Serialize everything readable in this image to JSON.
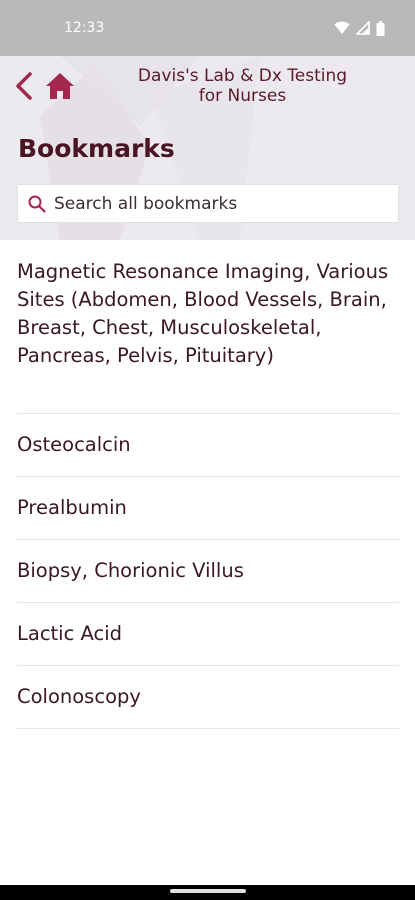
{
  "status_bar": {
    "time": "12:33",
    "icons": [
      "wifi-icon",
      "signal-icon",
      "battery-icon"
    ]
  },
  "header": {
    "title_line1": "Davis's Lab & Dx Testing",
    "title_line2": "for Nurses",
    "page_title": "Bookmarks",
    "back_icon": "chevron-left-icon",
    "home_icon": "home-icon"
  },
  "search": {
    "placeholder": "Search all bookmarks",
    "value": ""
  },
  "bookmarks": [
    "Magnetic Resonance Imaging, Various Sites (Abdomen, Blood Vessels, Brain, Breast, Chest, Musculoskeletal, Pancreas, Pelvis, Pituitary)",
    "Osteocalcin",
    "Prealbumin",
    "Biopsy, Chorionic Villus",
    "Lactic Acid",
    "Colonoscopy"
  ],
  "colors": {
    "accent": "#a3284e",
    "header_bg": "#eceaee",
    "title_text": "#4a1424",
    "status_bar": "#b9b8bb"
  }
}
